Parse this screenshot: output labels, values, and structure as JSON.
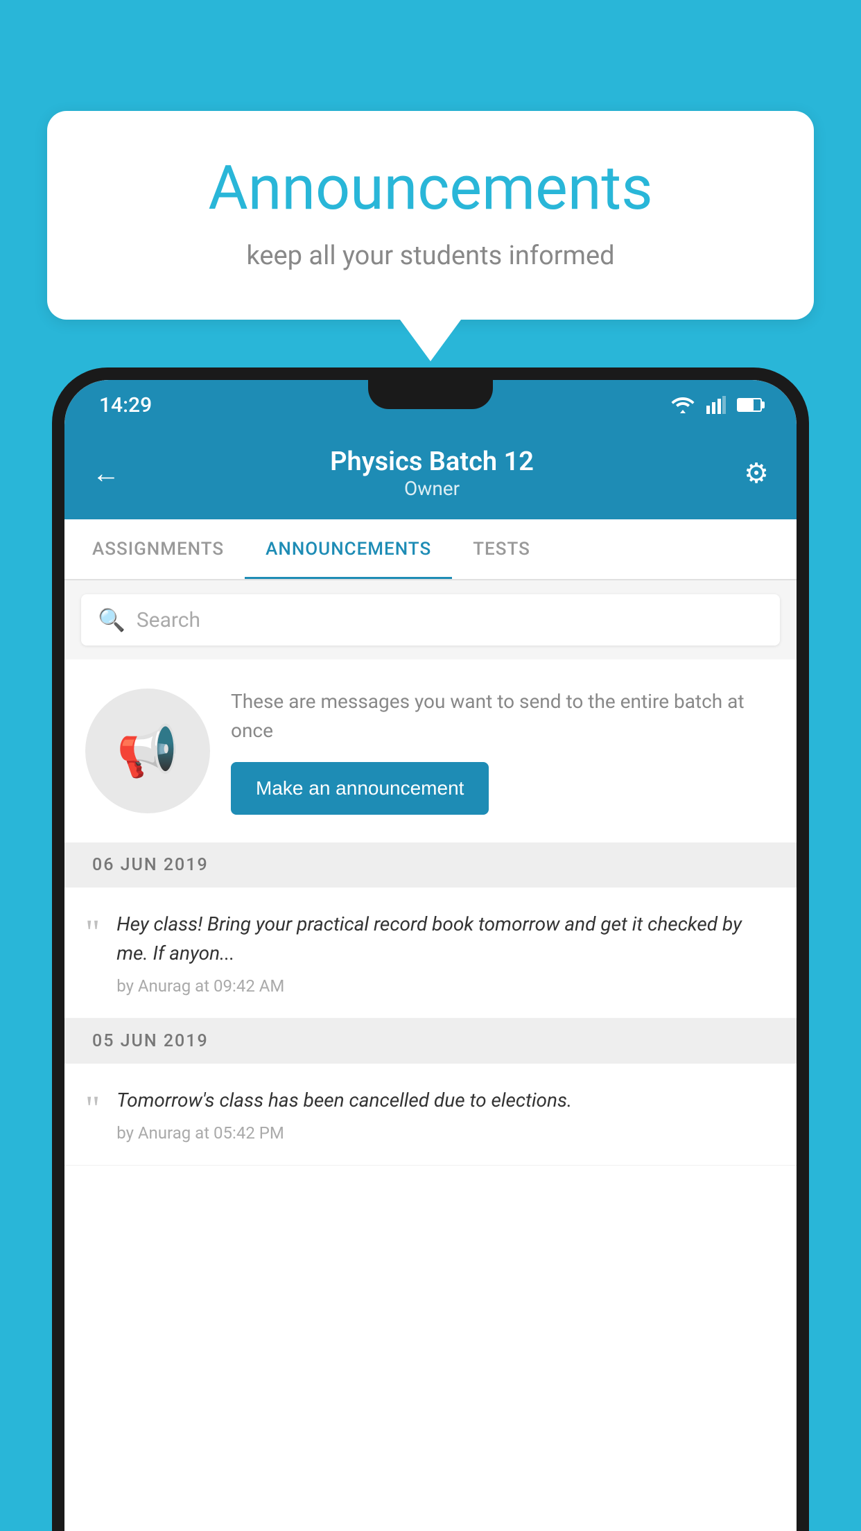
{
  "page": {
    "background_color": "#29b6d8"
  },
  "speech_bubble": {
    "title": "Announcements",
    "subtitle": "keep all your students informed"
  },
  "status_bar": {
    "time": "14:29"
  },
  "header": {
    "title": "Physics Batch 12",
    "subtitle": "Owner",
    "back_label": "←",
    "gear_label": "⚙"
  },
  "tabs": [
    {
      "label": "ASSIGNMENTS",
      "active": false
    },
    {
      "label": "ANNOUNCEMENTS",
      "active": true
    },
    {
      "label": "TESTS",
      "active": false
    }
  ],
  "search": {
    "placeholder": "Search"
  },
  "promo": {
    "description": "These are messages you want to\nsend to the entire batch at once",
    "button_label": "Make an announcement"
  },
  "announcement_sections": [
    {
      "date": "06  JUN  2019",
      "items": [
        {
          "text": "Hey class! Bring your practical record book tomorrow and get it checked by me. If anyon...",
          "meta": "by Anurag at 09:42 AM"
        }
      ]
    },
    {
      "date": "05  JUN  2019",
      "items": [
        {
          "text": "Tomorrow's class has been cancelled due to elections.",
          "meta": "by Anurag at 05:42 PM"
        }
      ]
    }
  ]
}
